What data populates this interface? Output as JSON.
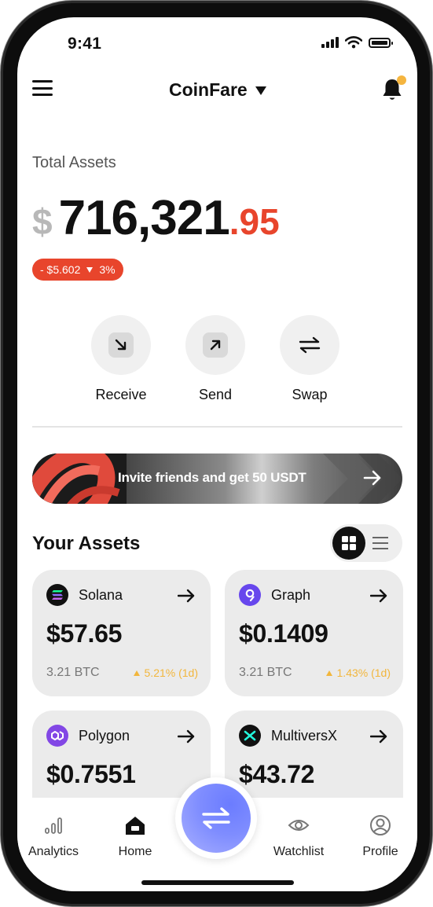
{
  "status_bar": {
    "time": "9:41"
  },
  "header": {
    "app_name": "CoinFare"
  },
  "portfolio": {
    "label": "Total Assets",
    "currency_symbol": "$",
    "balance_integer": "716,321",
    "balance_decimal": ".95",
    "change_amount": "- $5.602",
    "change_percent": "3%",
    "change_direction": "down",
    "change_color": "#e8452c"
  },
  "actions": [
    {
      "label": "Receive",
      "icon": "arrow-down-right-icon"
    },
    {
      "label": "Send",
      "icon": "arrow-up-right-icon"
    },
    {
      "label": "Swap",
      "icon": "swap-icon"
    }
  ],
  "promo": {
    "text": "Invite friends and get 50 USDT",
    "icon": "arrow-right-icon"
  },
  "assets_section": {
    "title": "Your Assets",
    "view_mode": "grid"
  },
  "assets": [
    {
      "name": "Solana",
      "price": "$57.65",
      "holding": "3.21 BTC",
      "change": "5.21% (1d)",
      "icon": "solana-icon",
      "icon_bg": "#111111"
    },
    {
      "name": "Graph",
      "price": "$0.1409",
      "holding": "3.21 BTC",
      "change": "1.43% (1d)",
      "icon": "graph-icon",
      "icon_bg": "#6747ed"
    },
    {
      "name": "Polygon",
      "price": "$0.7551",
      "holding": "",
      "change": "",
      "icon": "polygon-icon",
      "icon_bg": "#8247e5"
    },
    {
      "name": "MultiversX",
      "price": "$43.72",
      "holding": "",
      "change": "",
      "icon": "multiversx-icon",
      "icon_bg": "#111111"
    }
  ],
  "bottom_nav": {
    "items": [
      {
        "label": "Analytics",
        "icon": "bar-chart-icon"
      },
      {
        "label": "Home",
        "icon": "home-icon",
        "active": true
      },
      {
        "label": "Watchlist",
        "icon": "eye-icon"
      },
      {
        "label": "Profile",
        "icon": "user-circle-icon"
      }
    ],
    "center_action": {
      "icon": "swap-icon",
      "color": "#7f8dff"
    }
  },
  "colors": {
    "accent_negative": "#e8452c",
    "accent_positive": "#f2b63c",
    "notification_dot": "#f5b53f"
  }
}
